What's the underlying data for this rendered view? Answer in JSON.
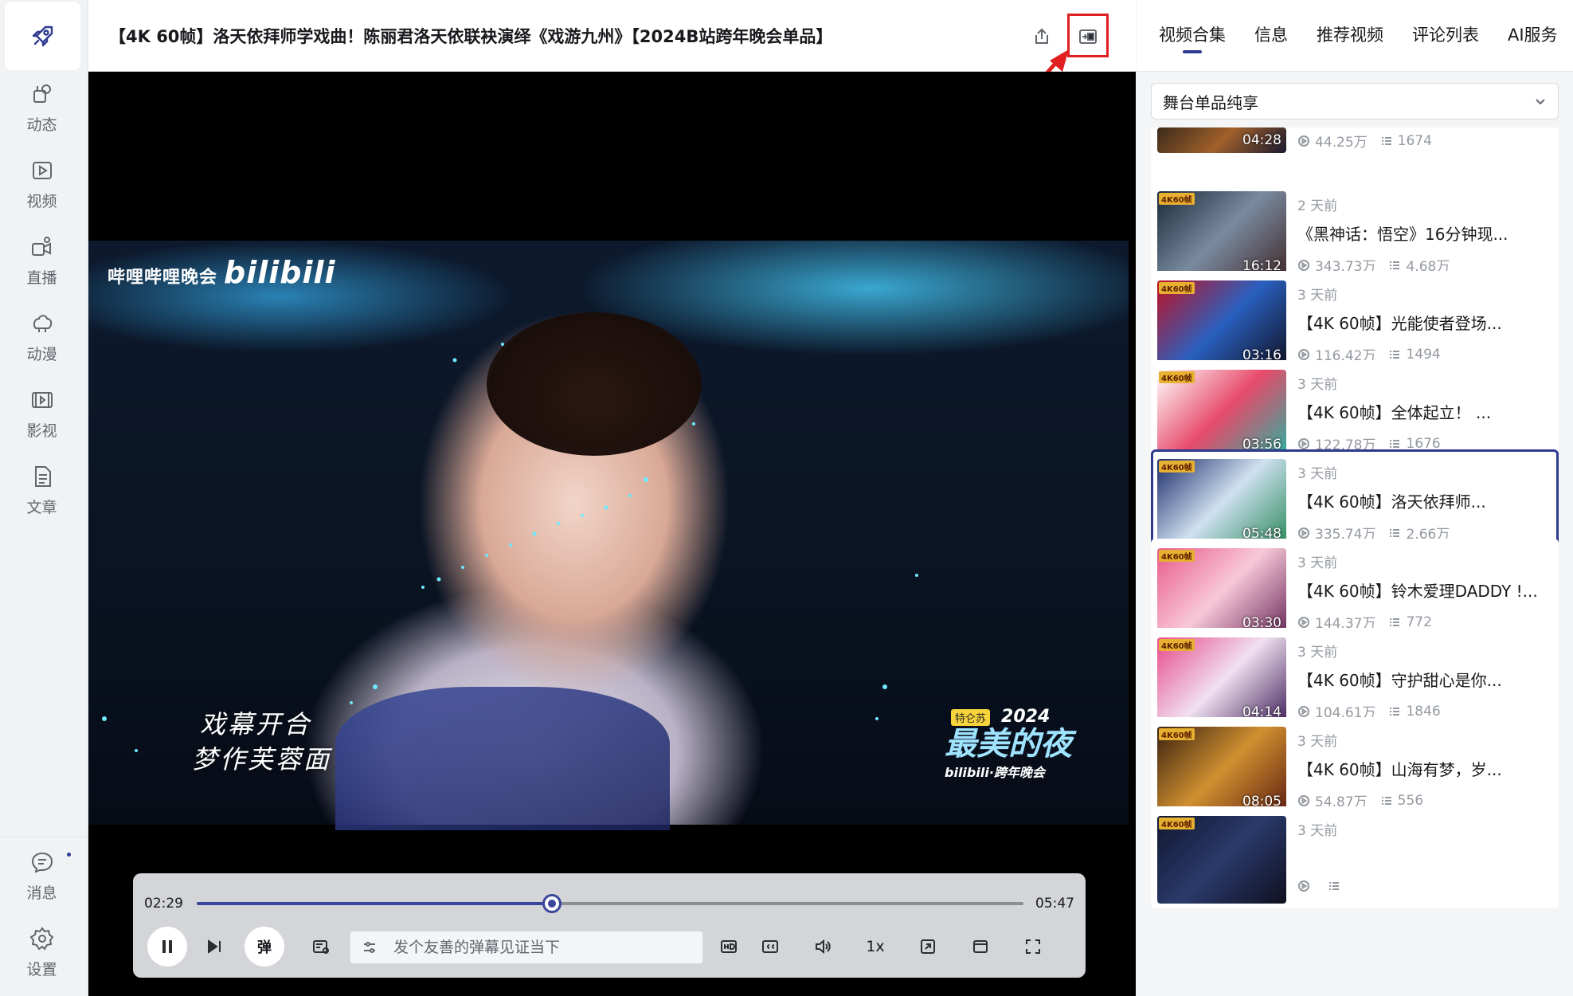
{
  "sidebar": {
    "logo": "rocket-icon",
    "items": [
      {
        "label": "动态",
        "icon": "dynamic-icon"
      },
      {
        "label": "视频",
        "icon": "video-play-icon"
      },
      {
        "label": "直播",
        "icon": "live-icon"
      },
      {
        "label": "动漫",
        "icon": "anime-icon"
      },
      {
        "label": "影视",
        "icon": "film-icon"
      },
      {
        "label": "文章",
        "icon": "article-icon"
      }
    ],
    "bottom": [
      {
        "label": "消息",
        "icon": "message-icon"
      },
      {
        "label": "设置",
        "icon": "settings-icon"
      }
    ]
  },
  "header": {
    "title": "【4K 60帧】洛天依拜师学戏曲！陈丽君洛天依联袂演绎《戏游九州》【2024B站跨年晚会单品】"
  },
  "video": {
    "watermark_text": "哔哩哔哩晚会",
    "watermark_logo": "bilibili",
    "lyrics": [
      "戏幕开合",
      "梦作芙蓉面"
    ],
    "event": {
      "tag": "特仑苏",
      "year": "2024",
      "name": "最美的夜",
      "sub": "bilibili·跨年晚会"
    }
  },
  "player": {
    "current_time": "02:29",
    "total_time": "05:47",
    "progress": 0.43,
    "danmaku_toggle_label": "弹",
    "danmaku_placeholder": "发个友善的弹幕见证当下",
    "speed_label": "1x"
  },
  "right_panel": {
    "tabs": [
      "视频合集",
      "信息",
      "推荐视频",
      "评论列表",
      "AI服务"
    ],
    "active_tab": "视频合集",
    "dropdown_value": "舞台单品纯享",
    "list": [
      {
        "when": "",
        "title": "",
        "duration": "04:28",
        "views": "44.25万",
        "danmaku": "1674",
        "active": false
      },
      {
        "when": "2 天前",
        "title": "《黑神话：悟空》16分钟现...",
        "duration": "16:12",
        "views": "343.73万",
        "danmaku": "4.68万",
        "active": false
      },
      {
        "when": "3 天前",
        "title": "【4K 60帧】光能使者登场...",
        "duration": "03:16",
        "views": "116.42万",
        "danmaku": "1494",
        "active": false
      },
      {
        "when": "3 天前",
        "title": "【4K 60帧】全体起立！ ...",
        "duration": "03:56",
        "views": "122.78万",
        "danmaku": "1676",
        "active": false
      },
      {
        "when": "3 天前",
        "title": "【4K 60帧】洛天依拜师...",
        "duration": "05:48",
        "views": "335.74万",
        "danmaku": "2.66万",
        "active": true
      },
      {
        "when": "3 天前",
        "title": "【4K 60帧】铃木爱理DADDY !...",
        "duration": "03:30",
        "views": "144.37万",
        "danmaku": "772",
        "active": false
      },
      {
        "when": "3 天前",
        "title": "【4K 60帧】守护甜心是你...",
        "duration": "04:14",
        "views": "104.61万",
        "danmaku": "1846",
        "active": false
      },
      {
        "when": "3 天前",
        "title": "【4K 60帧】山海有梦，岁...",
        "duration": "08:05",
        "views": "54.87万",
        "danmaku": "556",
        "active": false
      },
      {
        "when": "3 天前",
        "title": "",
        "duration": "",
        "views": "",
        "danmaku": "",
        "active": false
      }
    ],
    "thumb_badge": "4K60帧"
  },
  "colors": {
    "accent": "#2f3a8f",
    "highlight": "#e02020"
  }
}
